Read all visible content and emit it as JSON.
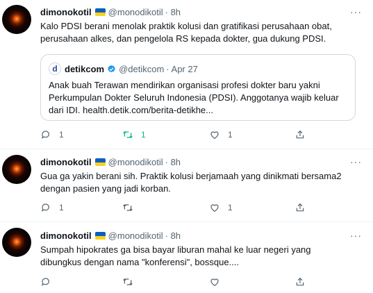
{
  "tweets": [
    {
      "name": "dimonokotil",
      "handle": "@monodikotil",
      "time": "· 8h",
      "text_lines": [
        "Kalo PDSI berani menolak praktik kolusi dan gratifikasi perusahaan obat,",
        "perusahaan alkes, dan pengelola RS kepada dokter, gua dukung PDSI."
      ],
      "quote": {
        "logo": "d",
        "name": "detikcom",
        "handle": "@detikcom",
        "time": "· Apr 27",
        "text_lines": [
          "Anak buah Terawan mendirikan organisasi profesi dokter baru yakni",
          "Perkumpulan Dokter Seluruh Indonesia (PDSI). Anggotanya wajib keluar",
          "dari IDI. health.detik.com/berita-detikhe..."
        ]
      },
      "replies": "1",
      "retweets": "1",
      "likes": "1",
      "retweeted": true
    },
    {
      "name": "dimonokotil",
      "handle": "@monodikotil",
      "time": "· 8h",
      "text_lines": [
        "Gua ga yakin berani sih. Praktik kolusi berjamaah yang dinikmati bersama2",
        "dengan pasien yang jadi korban."
      ],
      "replies": "1",
      "retweets": "",
      "likes": "1",
      "retweeted": false
    },
    {
      "name": "dimonokotil",
      "handle": "@monodikotil",
      "time": "· 8h",
      "text_lines": [
        "Sumpah hipokrates ga bisa bayar liburan mahal ke luar negeri yang",
        "dibungkus dengan nama \"konferensi\", bossque...."
      ],
      "replies": "",
      "retweets": "",
      "likes": "",
      "retweeted": false
    }
  ],
  "more_icon": "···",
  "colors": {
    "retweet_active": "#00ba7c",
    "muted": "#536471",
    "verified": "#1d9bf0",
    "border": "#cfd9de"
  }
}
